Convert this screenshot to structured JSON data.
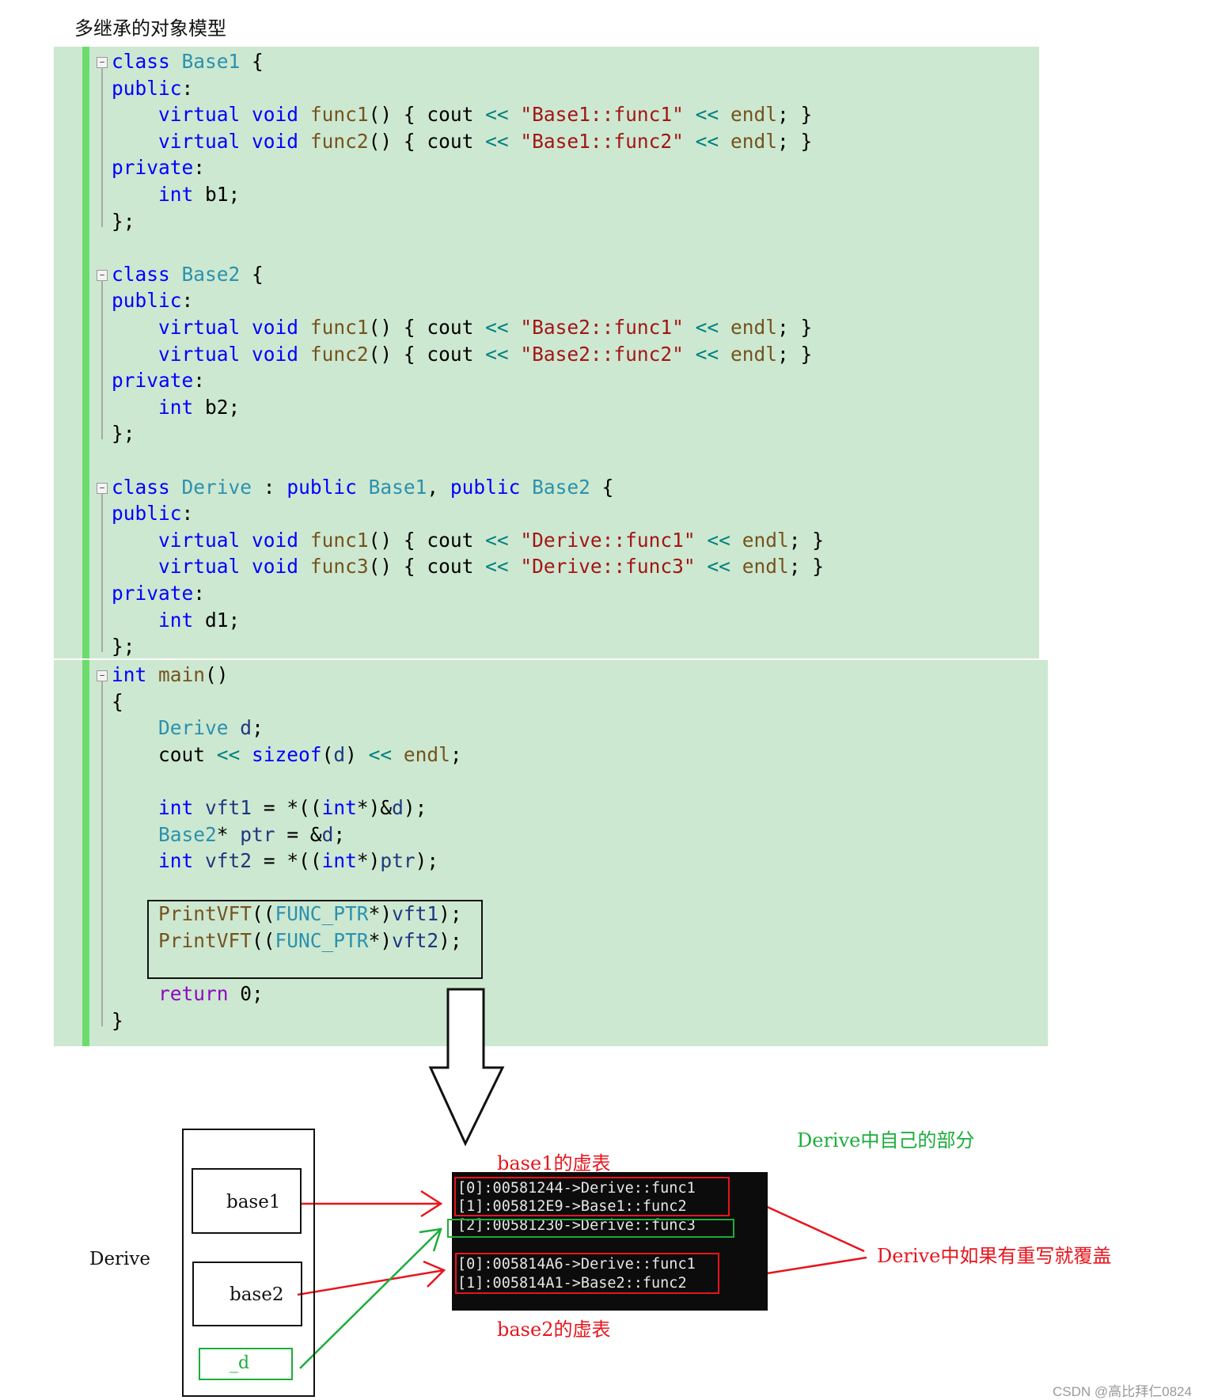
{
  "title": "多继承的对象模型",
  "code_block_1": [
    [
      [
        "k",
        "class"
      ],
      [
        "p",
        " "
      ],
      [
        "t",
        "Base1"
      ],
      [
        "p",
        " {"
      ]
    ],
    [
      [
        "k",
        "public"
      ],
      [
        "p",
        ":"
      ]
    ],
    [
      [
        "p",
        "    "
      ],
      [
        "k",
        "virtual"
      ],
      [
        "p",
        " "
      ],
      [
        "k",
        "void"
      ],
      [
        "p",
        " "
      ],
      [
        "f",
        "func1"
      ],
      [
        "p",
        "() { cout "
      ],
      [
        "o",
        "<<"
      ],
      [
        "p",
        " "
      ],
      [
        "s",
        "\"Base1::func1\""
      ],
      [
        "p",
        " "
      ],
      [
        "o",
        "<<"
      ],
      [
        "p",
        " "
      ],
      [
        "f",
        "endl"
      ],
      [
        "p",
        "; }"
      ]
    ],
    [
      [
        "p",
        "    "
      ],
      [
        "k",
        "virtual"
      ],
      [
        "p",
        " "
      ],
      [
        "k",
        "void"
      ],
      [
        "p",
        " "
      ],
      [
        "f",
        "func2"
      ],
      [
        "p",
        "() { cout "
      ],
      [
        "o",
        "<<"
      ],
      [
        "p",
        " "
      ],
      [
        "s",
        "\"Base1::func2\""
      ],
      [
        "p",
        " "
      ],
      [
        "o",
        "<<"
      ],
      [
        "p",
        " "
      ],
      [
        "f",
        "endl"
      ],
      [
        "p",
        "; }"
      ]
    ],
    [
      [
        "k",
        "private"
      ],
      [
        "p",
        ":"
      ]
    ],
    [
      [
        "p",
        "    "
      ],
      [
        "k",
        "int"
      ],
      [
        "p",
        " b1;"
      ]
    ],
    [
      [
        "p",
        "};"
      ]
    ],
    [],
    [
      [
        "k",
        "class"
      ],
      [
        "p",
        " "
      ],
      [
        "t",
        "Base2"
      ],
      [
        "p",
        " {"
      ]
    ],
    [
      [
        "k",
        "public"
      ],
      [
        "p",
        ":"
      ]
    ],
    [
      [
        "p",
        "    "
      ],
      [
        "k",
        "virtual"
      ],
      [
        "p",
        " "
      ],
      [
        "k",
        "void"
      ],
      [
        "p",
        " "
      ],
      [
        "f",
        "func1"
      ],
      [
        "p",
        "() { cout "
      ],
      [
        "o",
        "<<"
      ],
      [
        "p",
        " "
      ],
      [
        "s",
        "\"Base2::func1\""
      ],
      [
        "p",
        " "
      ],
      [
        "o",
        "<<"
      ],
      [
        "p",
        " "
      ],
      [
        "f",
        "endl"
      ],
      [
        "p",
        "; }"
      ]
    ],
    [
      [
        "p",
        "    "
      ],
      [
        "k",
        "virtual"
      ],
      [
        "p",
        " "
      ],
      [
        "k",
        "void"
      ],
      [
        "p",
        " "
      ],
      [
        "f",
        "func2"
      ],
      [
        "p",
        "() { cout "
      ],
      [
        "o",
        "<<"
      ],
      [
        "p",
        " "
      ],
      [
        "s",
        "\"Base2::func2\""
      ],
      [
        "p",
        " "
      ],
      [
        "o",
        "<<"
      ],
      [
        "p",
        " "
      ],
      [
        "f",
        "endl"
      ],
      [
        "p",
        "; }"
      ]
    ],
    [
      [
        "k",
        "private"
      ],
      [
        "p",
        ":"
      ]
    ],
    [
      [
        "p",
        "    "
      ],
      [
        "k",
        "int"
      ],
      [
        "p",
        " b2;"
      ]
    ],
    [
      [
        "p",
        "};"
      ]
    ],
    [],
    [
      [
        "k",
        "class"
      ],
      [
        "p",
        " "
      ],
      [
        "t",
        "Derive"
      ],
      [
        "p",
        " : "
      ],
      [
        "k",
        "public"
      ],
      [
        "p",
        " "
      ],
      [
        "t",
        "Base1"
      ],
      [
        "p",
        ", "
      ],
      [
        "k",
        "public"
      ],
      [
        "p",
        " "
      ],
      [
        "t",
        "Base2"
      ],
      [
        "p",
        " {"
      ]
    ],
    [
      [
        "k",
        "public"
      ],
      [
        "p",
        ":"
      ]
    ],
    [
      [
        "p",
        "    "
      ],
      [
        "k",
        "virtual"
      ],
      [
        "p",
        " "
      ],
      [
        "k",
        "void"
      ],
      [
        "p",
        " "
      ],
      [
        "f",
        "func1"
      ],
      [
        "p",
        "() { cout "
      ],
      [
        "o",
        "<<"
      ],
      [
        "p",
        " "
      ],
      [
        "s",
        "\"Derive::func1\""
      ],
      [
        "p",
        " "
      ],
      [
        "o",
        "<<"
      ],
      [
        "p",
        " "
      ],
      [
        "f",
        "endl"
      ],
      [
        "p",
        "; }"
      ]
    ],
    [
      [
        "p",
        "    "
      ],
      [
        "k",
        "virtual"
      ],
      [
        "p",
        " "
      ],
      [
        "k",
        "void"
      ],
      [
        "p",
        " "
      ],
      [
        "f",
        "func3"
      ],
      [
        "p",
        "() { cout "
      ],
      [
        "o",
        "<<"
      ],
      [
        "p",
        " "
      ],
      [
        "s",
        "\"Derive::func3\""
      ],
      [
        "p",
        " "
      ],
      [
        "o",
        "<<"
      ],
      [
        "p",
        " "
      ],
      [
        "f",
        "endl"
      ],
      [
        "p",
        "; }"
      ]
    ],
    [
      [
        "k",
        "private"
      ],
      [
        "p",
        ":"
      ]
    ],
    [
      [
        "p",
        "    "
      ],
      [
        "k",
        "int"
      ],
      [
        "p",
        " d1;"
      ]
    ],
    [
      [
        "p",
        "};"
      ]
    ]
  ],
  "code_block_2": [
    [
      [
        "k",
        "int"
      ],
      [
        "p",
        " "
      ],
      [
        "f",
        "main"
      ],
      [
        "p",
        "()"
      ]
    ],
    [
      [
        "p",
        "{"
      ]
    ],
    [
      [
        "p",
        "    "
      ],
      [
        "t",
        "Derive"
      ],
      [
        "p",
        " "
      ],
      [
        "v",
        "d"
      ],
      [
        "p",
        ";"
      ]
    ],
    [
      [
        "p",
        "    cout "
      ],
      [
        "o",
        "<<"
      ],
      [
        "p",
        " "
      ],
      [
        "k",
        "sizeof"
      ],
      [
        "p",
        "("
      ],
      [
        "v",
        "d"
      ],
      [
        "p",
        ") "
      ],
      [
        "o",
        "<<"
      ],
      [
        "p",
        " "
      ],
      [
        "f",
        "endl"
      ],
      [
        "p",
        ";"
      ]
    ],
    [],
    [
      [
        "p",
        "    "
      ],
      [
        "k",
        "int"
      ],
      [
        "p",
        " "
      ],
      [
        "v",
        "vft1"
      ],
      [
        "p",
        " = *(("
      ],
      [
        "k",
        "int"
      ],
      [
        "p",
        "*)&"
      ],
      [
        "v",
        "d"
      ],
      [
        "p",
        ");"
      ]
    ],
    [
      [
        "p",
        "    "
      ],
      [
        "t",
        "Base2"
      ],
      [
        "p",
        "* "
      ],
      [
        "v",
        "ptr"
      ],
      [
        "p",
        " = &"
      ],
      [
        "v",
        "d"
      ],
      [
        "p",
        ";"
      ]
    ],
    [
      [
        "p",
        "    "
      ],
      [
        "k",
        "int"
      ],
      [
        "p",
        " "
      ],
      [
        "v",
        "vft2"
      ],
      [
        "p",
        " = *(("
      ],
      [
        "k",
        "int"
      ],
      [
        "p",
        "*)"
      ],
      [
        "v",
        "ptr"
      ],
      [
        "p",
        ");"
      ]
    ],
    [],
    [
      [
        "p",
        "    "
      ],
      [
        "f",
        "PrintVFT"
      ],
      [
        "p",
        "(("
      ],
      [
        "t",
        "FUNC_PTR"
      ],
      [
        "p",
        "*)"
      ],
      [
        "v",
        "vft1"
      ],
      [
        "p",
        ");"
      ]
    ],
    [
      [
        "p",
        "    "
      ],
      [
        "f",
        "PrintVFT"
      ],
      [
        "p",
        "(("
      ],
      [
        "t",
        "FUNC_PTR"
      ],
      [
        "p",
        "*)"
      ],
      [
        "v",
        "vft2"
      ],
      [
        "p",
        ");"
      ]
    ],
    [],
    [
      [
        "p",
        "    "
      ],
      [
        "r",
        "return"
      ],
      [
        "p",
        " 0;"
      ]
    ],
    [
      [
        "p",
        "}"
      ]
    ]
  ],
  "diagram": {
    "derive_label": "Derive",
    "base1_label": "base1",
    "base2_label": "base2",
    "d_label": "_d",
    "base1_vtable_label": "base1的虚表",
    "base2_vtable_label": "base2的虚表",
    "own_part_label": "Derive中自己的部分",
    "override_label": "Derive中如果有重写就覆盖",
    "console_rows": [
      "[0]:00581244->Derive::func1",
      "[1]:005812E9->Base1::func2",
      "[2]:00581230->Derive::func3",
      "[0]:005814A6->Derive::func1",
      "[1]:005814A1->Base2::func2"
    ],
    "colors": {
      "red": "#e8141c",
      "green": "#1aae3a",
      "code_bg": "#cde8d0"
    }
  },
  "watermark": "CSDN @高比拜仁0824"
}
